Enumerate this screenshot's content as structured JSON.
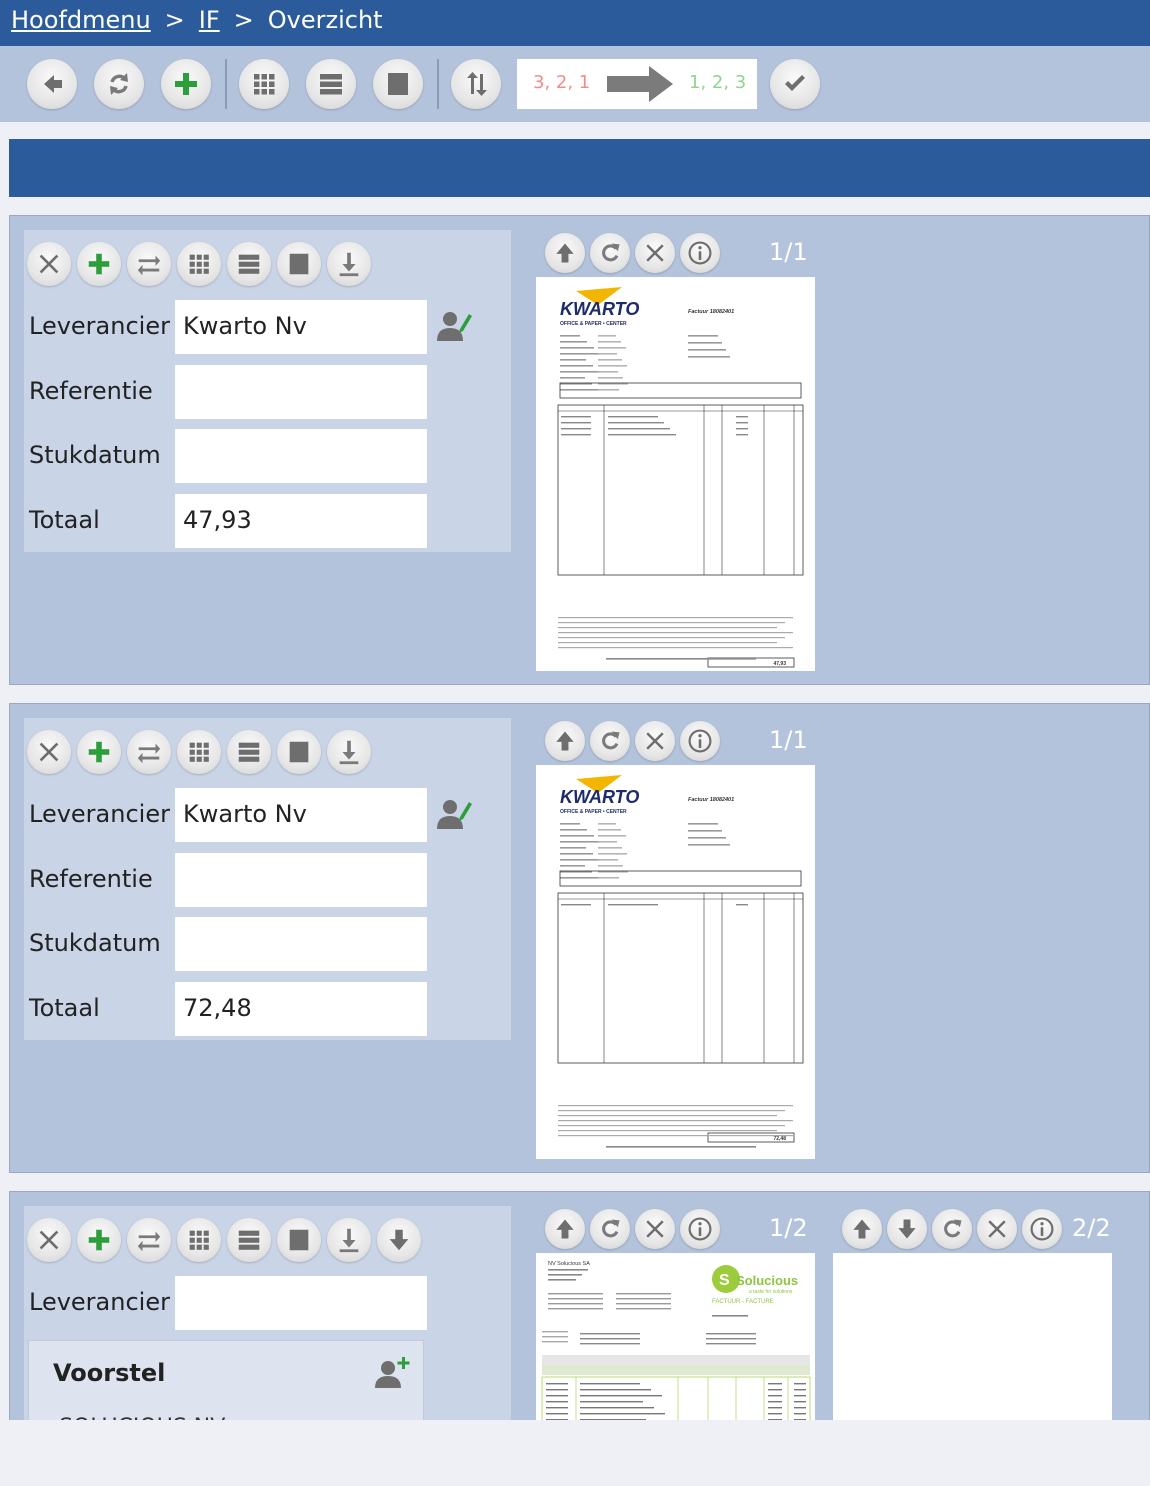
{
  "breadcrumb": {
    "home": "Hoofdmenu",
    "section": "IF",
    "current": "Overzicht",
    "separator": ">"
  },
  "toolbar": {
    "sort_from": "3, 2, 1",
    "sort_to": "1, 2, 3",
    "icons": [
      "back-icon",
      "refresh-icon",
      "add-icon",
      "grid-view-icon",
      "list-view-icon",
      "single-view-icon",
      "sort-icon",
      "confirm-icon"
    ]
  },
  "colors": {
    "header": "#2b5b9a",
    "card": "#b3c3dc",
    "panel": "#c9d4e7",
    "add": "#2e9e3c"
  },
  "labels": {
    "leverancier": "Leverancier",
    "referentie": "Referentie",
    "stukdatum": "Stukdatum",
    "totaal": "Totaal"
  },
  "cards": [
    {
      "leverancier": "Kwarto Nv",
      "referentie": "",
      "stukdatum": "",
      "totaal": "47,93",
      "page": "1/1",
      "doc": {
        "brand": "KWARTO",
        "tagline": "OFFICE & PAPER • CENTER",
        "factuur": "Factuur 18082401",
        "total": "47,93"
      }
    },
    {
      "leverancier": "Kwarto Nv",
      "referentie": "",
      "stukdatum": "",
      "totaal": "72,48",
      "page": "1/1",
      "doc": {
        "brand": "KWARTO",
        "tagline": "OFFICE & PAPER • CENTER",
        "factuur": "Factuur 18082401",
        "total": "72,48"
      }
    },
    {
      "leverancier": "",
      "page": "1/2",
      "page2": "2/2",
      "voorstel": {
        "title": "Voorstel",
        "item": "SOLUCIOUS NV"
      },
      "doc": {
        "company": "NV Solucious SA",
        "brand": "Solucious",
        "tagline": "a taste for solutions",
        "factuur": "FACTUUR - FACTURE"
      }
    }
  ]
}
